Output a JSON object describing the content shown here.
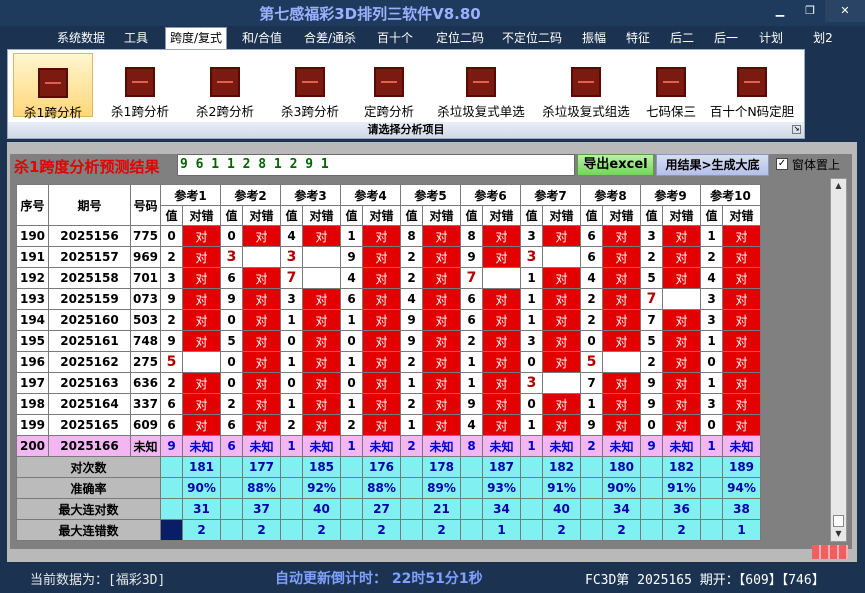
{
  "window": {
    "title": "第七感福彩3D排列三软件V8.80"
  },
  "menu": [
    "系统数据",
    "工具",
    "跨度/复式",
    "和/合值",
    "合差/通杀",
    "百十个",
    "定位二码",
    "不定位二码",
    "振幅",
    "特征",
    "后二",
    "后一",
    "计划",
    "划2"
  ],
  "menu_active_index": 2,
  "ribbon": {
    "buttons": [
      "杀1跨分析",
      "杀1跨分析",
      "杀2跨分析",
      "杀3跨分析",
      "定跨分析",
      "杀垃圾复式单选",
      "杀垃圾复式组选",
      "七码保三",
      "百十个N码定胆"
    ],
    "active_index": 0,
    "footer": "请选择分析项目"
  },
  "result": {
    "label": "杀1跨度分析预测结果",
    "value": "9 6 1 1 2 8 1 2 9 1",
    "export_button": "导出excel",
    "generate_button": "用结果>生成大底",
    "pin_checkbox": "窗体置上",
    "pin_checked": true
  },
  "table": {
    "col_headers": [
      "序号",
      "期号",
      "号码"
    ],
    "ref_headers": [
      "参考1",
      "参考2",
      "参考3",
      "参考4",
      "参考5",
      "参考6",
      "参考7",
      "参考8",
      "参考9",
      "参考10"
    ],
    "sub_value": "值",
    "sub_result": "对错",
    "ok_text": "对",
    "rows": [
      {
        "seq": "190",
        "issue": "2025156",
        "num": "775",
        "vals": [
          "0",
          "0",
          "4",
          "1",
          "8",
          "8",
          "3",
          "6",
          "3",
          "1"
        ],
        "hit": [
          0,
          0,
          0,
          0,
          0,
          0,
          0,
          0,
          0,
          0
        ]
      },
      {
        "seq": "191",
        "issue": "2025157",
        "num": "969",
        "vals": [
          "2",
          "3",
          "3",
          "9",
          "2",
          "9",
          "3",
          "6",
          "2",
          "2"
        ],
        "hit": [
          0,
          1,
          1,
          0,
          0,
          0,
          1,
          0,
          0,
          0
        ]
      },
      {
        "seq": "192",
        "issue": "2025158",
        "num": "701",
        "vals": [
          "3",
          "6",
          "7",
          "4",
          "2",
          "7",
          "1",
          "4",
          "5",
          "4"
        ],
        "hit": [
          0,
          0,
          1,
          0,
          0,
          1,
          0,
          0,
          0,
          0
        ]
      },
      {
        "seq": "193",
        "issue": "2025159",
        "num": "073",
        "vals": [
          "9",
          "9",
          "3",
          "6",
          "4",
          "6",
          "1",
          "2",
          "7",
          "3"
        ],
        "hit": [
          0,
          0,
          0,
          0,
          0,
          0,
          0,
          0,
          1,
          0
        ]
      },
      {
        "seq": "194",
        "issue": "2025160",
        "num": "503",
        "vals": [
          "2",
          "0",
          "1",
          "1",
          "9",
          "6",
          "1",
          "2",
          "7",
          "3"
        ],
        "hit": [
          0,
          0,
          0,
          0,
          0,
          0,
          0,
          0,
          0,
          0
        ]
      },
      {
        "seq": "195",
        "issue": "2025161",
        "num": "748",
        "vals": [
          "9",
          "5",
          "0",
          "0",
          "9",
          "2",
          "3",
          "0",
          "5",
          "1"
        ],
        "hit": [
          0,
          0,
          0,
          0,
          0,
          0,
          0,
          0,
          0,
          0
        ]
      },
      {
        "seq": "196",
        "issue": "2025162",
        "num": "275",
        "vals": [
          "5",
          "0",
          "1",
          "1",
          "2",
          "1",
          "0",
          "5",
          "2",
          "0"
        ],
        "hit": [
          1,
          0,
          0,
          0,
          0,
          0,
          0,
          1,
          0,
          0
        ]
      },
      {
        "seq": "197",
        "issue": "2025163",
        "num": "636",
        "vals": [
          "2",
          "0",
          "0",
          "0",
          "1",
          "1",
          "3",
          "7",
          "9",
          "1"
        ],
        "hit": [
          0,
          0,
          0,
          0,
          0,
          0,
          1,
          0,
          0,
          0
        ]
      },
      {
        "seq": "198",
        "issue": "2025164",
        "num": "337",
        "vals": [
          "6",
          "2",
          "1",
          "1",
          "2",
          "9",
          "0",
          "1",
          "9",
          "3"
        ],
        "hit": [
          0,
          0,
          0,
          0,
          0,
          0,
          0,
          0,
          0,
          0
        ]
      },
      {
        "seq": "199",
        "issue": "2025165",
        "num": "609",
        "vals": [
          "6",
          "6",
          "2",
          "2",
          "1",
          "4",
          "1",
          "9",
          "0",
          "0"
        ],
        "hit": [
          0,
          0,
          0,
          0,
          0,
          0,
          0,
          0,
          0,
          0
        ]
      }
    ],
    "future": {
      "seq": "200",
      "issue": "2025166",
      "num": "未知",
      "vals": [
        "9",
        "6",
        "1",
        "1",
        "2",
        "8",
        "1",
        "2",
        "9",
        "1"
      ],
      "result": "未知"
    },
    "stats": [
      {
        "label": "对次数",
        "values": [
          "181",
          "177",
          "185",
          "176",
          "178",
          "187",
          "182",
          "180",
          "182",
          "189"
        ]
      },
      {
        "label": "准确率",
        "values": [
          "90%",
          "88%",
          "92%",
          "88%",
          "89%",
          "93%",
          "91%",
          "90%",
          "91%",
          "94%"
        ]
      },
      {
        "label": "最大连对数",
        "values": [
          "31",
          "37",
          "40",
          "27",
          "21",
          "34",
          "40",
          "34",
          "36",
          "38"
        ]
      },
      {
        "label": "最大连错数",
        "values": [
          "2",
          "2",
          "2",
          "2",
          "2",
          "1",
          "2",
          "2",
          "2",
          "1"
        ]
      }
    ]
  },
  "status": {
    "current": "当前数据为：[福彩3D]",
    "countdown": "自动更新倒计时：  22时51分1秒",
    "info": "FC3D第 2025165 期开：【609】【746】"
  },
  "colors": {
    "ok": "#e20000",
    "future": "#f3b6f3",
    "stat": "#80f0f0",
    "result_text": "#006600",
    "label": "#e30000"
  }
}
